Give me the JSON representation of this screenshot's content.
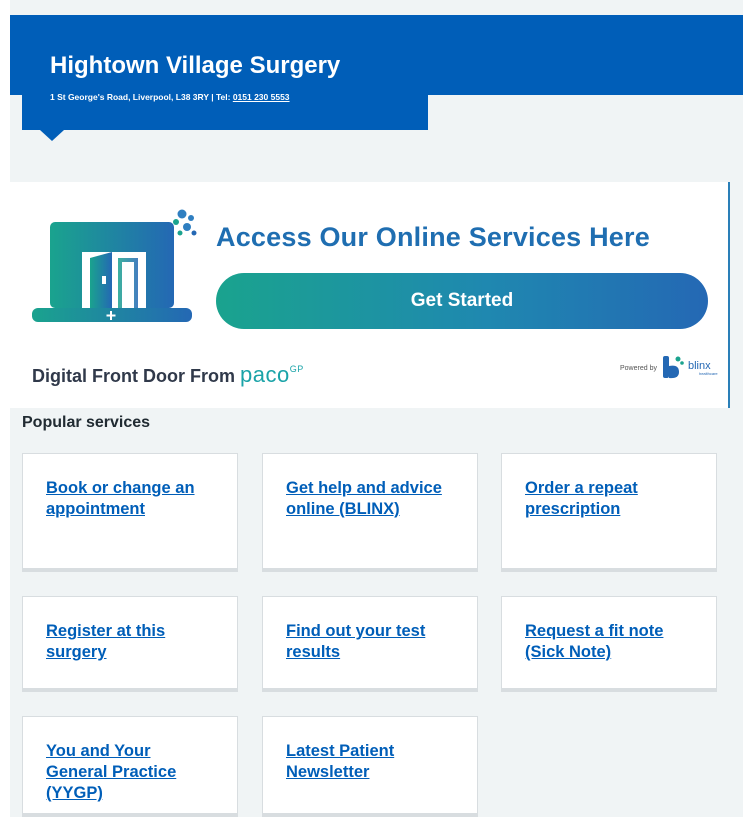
{
  "header": {
    "title": "Hightown Village Surgery",
    "address": "1 St George's Road, Liverpool, L38 3RY | Tel:",
    "phone": "0151 230 5553"
  },
  "banner": {
    "headline": "Access Our Online Services Here",
    "cta_label": "Get Started",
    "footer_text": "Digital Front Door From",
    "brand": "paco",
    "brand_sup": "GP",
    "powered_by": "Powered by",
    "partner": "blinx",
    "partner_tagline": "healthcare"
  },
  "services": {
    "title": "Popular services",
    "items": [
      {
        "label": "Book or change an appointment"
      },
      {
        "label": "Get help and advice online (BLINX)"
      },
      {
        "label": "Order a repeat prescription"
      },
      {
        "label": "Register at this surgery"
      },
      {
        "label": "Find out your test results"
      },
      {
        "label": "Request a fit note (Sick Note)"
      },
      {
        "label": "You and Your General Practice (YYGP)"
      },
      {
        "label": "Latest Patient Newsletter"
      }
    ]
  },
  "colors": {
    "brand_blue": "#005eb8",
    "link": "#005eb8",
    "teal": "#1aa38e",
    "background": "#f0f4f5"
  }
}
